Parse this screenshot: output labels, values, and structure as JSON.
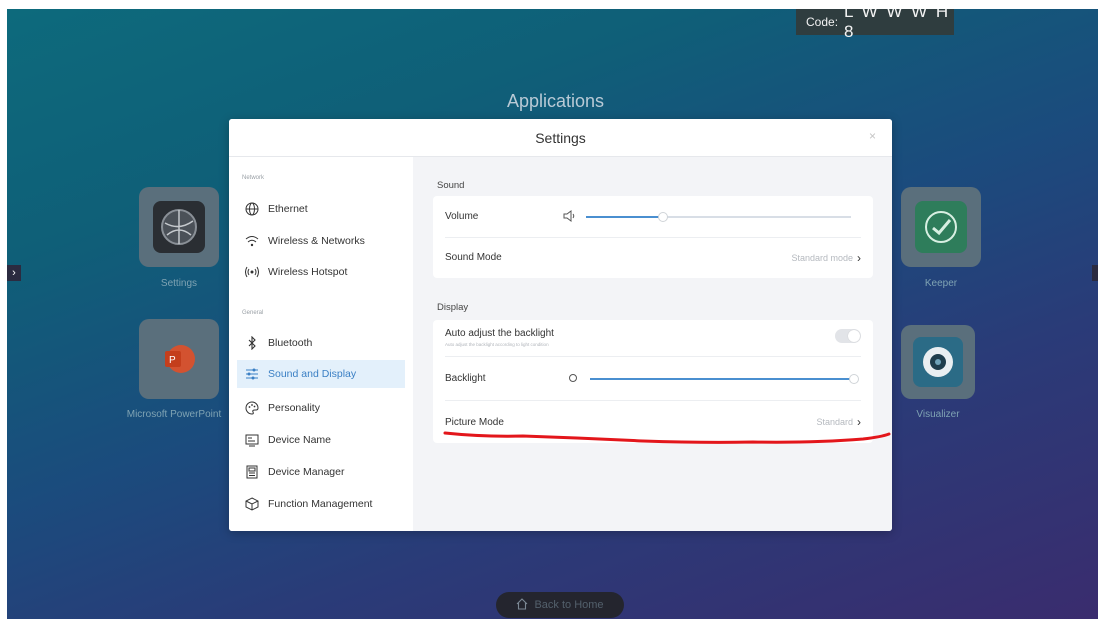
{
  "code": {
    "label": "Code:",
    "value": "L W W W H 8"
  },
  "apps_title": "Applications",
  "apps": [
    {
      "name": "Settings",
      "icon": "settings-globe-icon"
    },
    {
      "name": "Microsoft PowerPoint",
      "icon": "powerpoint-icon"
    },
    {
      "name": "Keeper",
      "icon": "keeper-check-icon"
    },
    {
      "name": "Visualizer",
      "icon": "visualizer-camera-icon"
    }
  ],
  "dialog": {
    "title": "Settings",
    "close": "×"
  },
  "sidebar": {
    "groups": {
      "network": "Network",
      "general": "General"
    },
    "items": [
      {
        "label": "Ethernet",
        "icon": "globe-icon"
      },
      {
        "label": "Wireless & Networks",
        "icon": "wifi-icon"
      },
      {
        "label": "Wireless Hotspot",
        "icon": "hotspot-icon"
      },
      {
        "label": "Bluetooth",
        "icon": "bluetooth-icon"
      },
      {
        "label": "Sound and Display",
        "icon": "sliders-icon"
      },
      {
        "label": "Personality",
        "icon": "palette-icon"
      },
      {
        "label": "Device Name",
        "icon": "device-name-icon"
      },
      {
        "label": "Device Manager",
        "icon": "device-manager-icon"
      },
      {
        "label": "Function Management",
        "icon": "cube-icon"
      }
    ],
    "active_index": 4
  },
  "sound": {
    "section_title": "Sound",
    "volume_label": "Volume",
    "volume_level": 0.29,
    "sound_mode_label": "Sound Mode",
    "sound_mode_value": "Standard mode"
  },
  "display": {
    "section_title": "Display",
    "auto_backlight_label": "Auto adjust the backlight",
    "auto_backlight_desc": "Auto adjust the backlight according to light condition",
    "auto_backlight_on": false,
    "backlight_label": "Backlight",
    "backlight_level": 1.0,
    "picture_mode_label": "Picture Mode",
    "picture_mode_value": "Standard"
  },
  "home_button": {
    "label": "Back to Home",
    "icon": "home-icon"
  },
  "colors": {
    "accent": "#4a8fd0",
    "annotation": "#e3161b",
    "active_bg": "#e3f0fb"
  }
}
